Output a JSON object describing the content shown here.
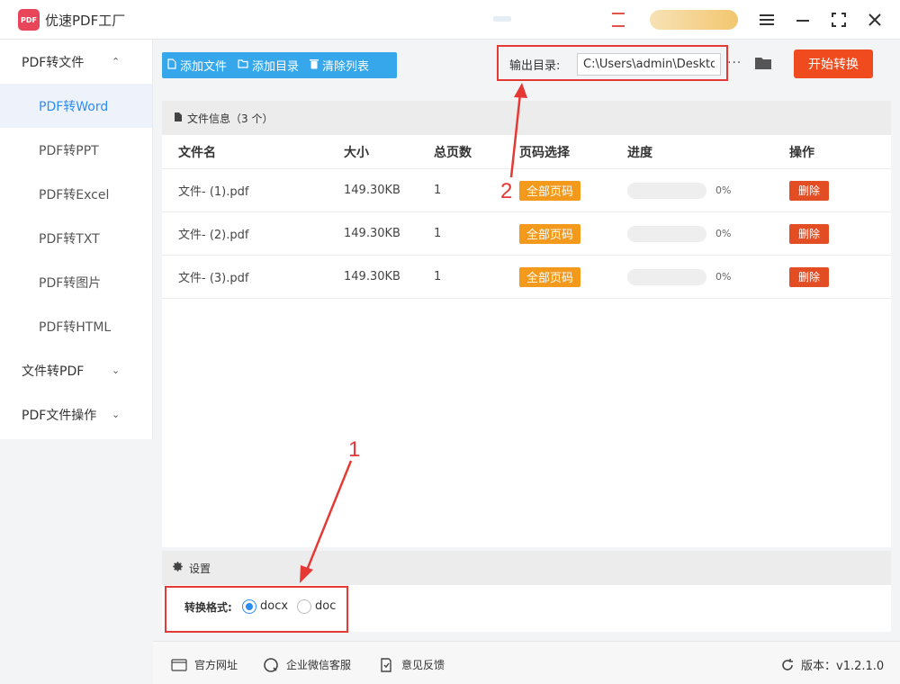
{
  "app": {
    "title": "优速PDF工厂",
    "logo_text": "PDF"
  },
  "window": {
    "menu_icon": "menu-icon",
    "minimize_icon": "minimize-icon",
    "maximize_icon": "maximize-icon",
    "close_icon": "close-icon"
  },
  "sidebar": {
    "groups": [
      {
        "label": "PDF转文件",
        "expanded": true,
        "items": [
          {
            "label": "PDF转Word",
            "active": true
          },
          {
            "label": "PDF转PPT"
          },
          {
            "label": "PDF转Excel"
          },
          {
            "label": "PDF转TXT"
          },
          {
            "label": "PDF转图片"
          },
          {
            "label": "PDF转HTML"
          }
        ]
      },
      {
        "label": "文件转PDF",
        "expanded": false
      },
      {
        "label": "PDF文件操作",
        "expanded": false
      }
    ]
  },
  "toolbar": {
    "add_file": "添加文件",
    "add_folder": "添加目录",
    "clear_list": "清除列表"
  },
  "output": {
    "label": "输出目录:",
    "path": "C:\\Users\\admin\\Desktop",
    "more": "···",
    "start_button": "开始转换"
  },
  "file_panel": {
    "title": "文件信息（3 个）",
    "headers": {
      "name": "文件名",
      "size": "大小",
      "pages": "总页数",
      "range": "页码选择",
      "progress": "进度",
      "op": "操作"
    },
    "rows": [
      {
        "name": "文件- (1).pdf",
        "size": "149.30KB",
        "pages": "1",
        "range": "全部页码",
        "progress_text": "0%",
        "progress_value": 0,
        "delete": "删除"
      },
      {
        "name": "文件- (2).pdf",
        "size": "149.30KB",
        "pages": "1",
        "range": "全部页码",
        "progress_text": "0%",
        "progress_value": 0,
        "delete": "删除"
      },
      {
        "name": "文件- (3).pdf",
        "size": "149.30KB",
        "pages": "1",
        "range": "全部页码",
        "progress_text": "0%",
        "progress_value": 0,
        "delete": "删除"
      }
    ]
  },
  "settings": {
    "title": "设置",
    "format_label": "转换格式:",
    "options": [
      {
        "label": "docx",
        "checked": true
      },
      {
        "label": "doc",
        "checked": false
      }
    ]
  },
  "annotations": {
    "one": "1",
    "two": "2"
  },
  "footer": {
    "website": "官方网址",
    "wechat": "企业微信客服",
    "feedback": "意见反馈",
    "version": "版本：v1.2.1.0"
  },
  "colors": {
    "accent": "#2d8cf0",
    "toolbar_blue": "#35a7ea",
    "start_red": "#f04b1e",
    "range_orange": "#f39a1c",
    "delete_red": "#e24d24",
    "annotation_red": "#e53935"
  }
}
